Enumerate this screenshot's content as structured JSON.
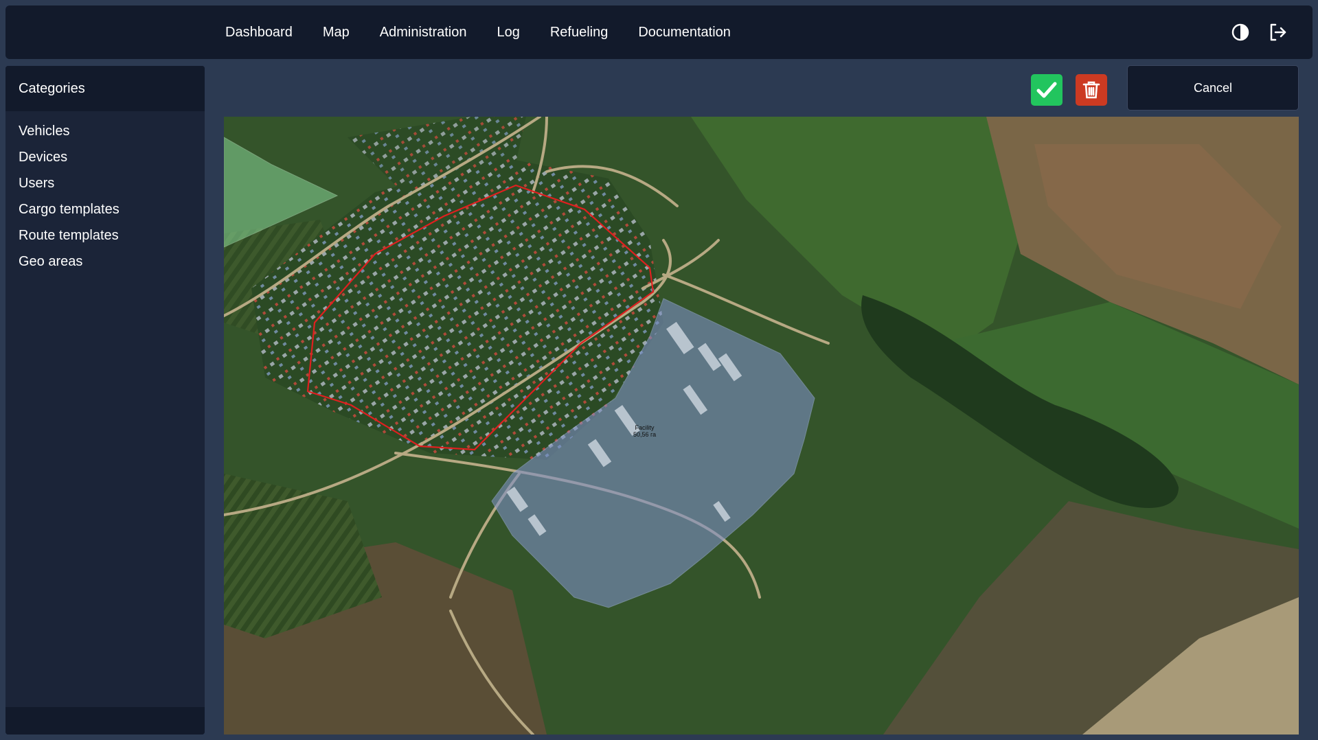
{
  "nav": {
    "items": [
      {
        "label": "Dashboard"
      },
      {
        "label": "Map"
      },
      {
        "label": "Administration"
      },
      {
        "label": "Log"
      },
      {
        "label": "Refueling"
      },
      {
        "label": "Documentation"
      }
    ],
    "icons": [
      "theme-toggle-icon",
      "logout-icon"
    ]
  },
  "sidebar": {
    "header": "Categories",
    "items": [
      {
        "label": "Vehicles"
      },
      {
        "label": "Devices"
      },
      {
        "label": "Users"
      },
      {
        "label": "Cargo templates"
      },
      {
        "label": "Route templates"
      },
      {
        "label": "Geo areas"
      }
    ]
  },
  "toolbar": {
    "confirm_icon": "check-icon",
    "delete_icon": "trash-icon",
    "cancel_label": "Cancel"
  },
  "map": {
    "area_label": {
      "name": "Facility",
      "size": "50,56 га"
    },
    "colors": {
      "selected_outline": "#e01f1f",
      "area_fill": "#7d8fc4",
      "neighbor_fill": "#8fe0a0"
    }
  }
}
